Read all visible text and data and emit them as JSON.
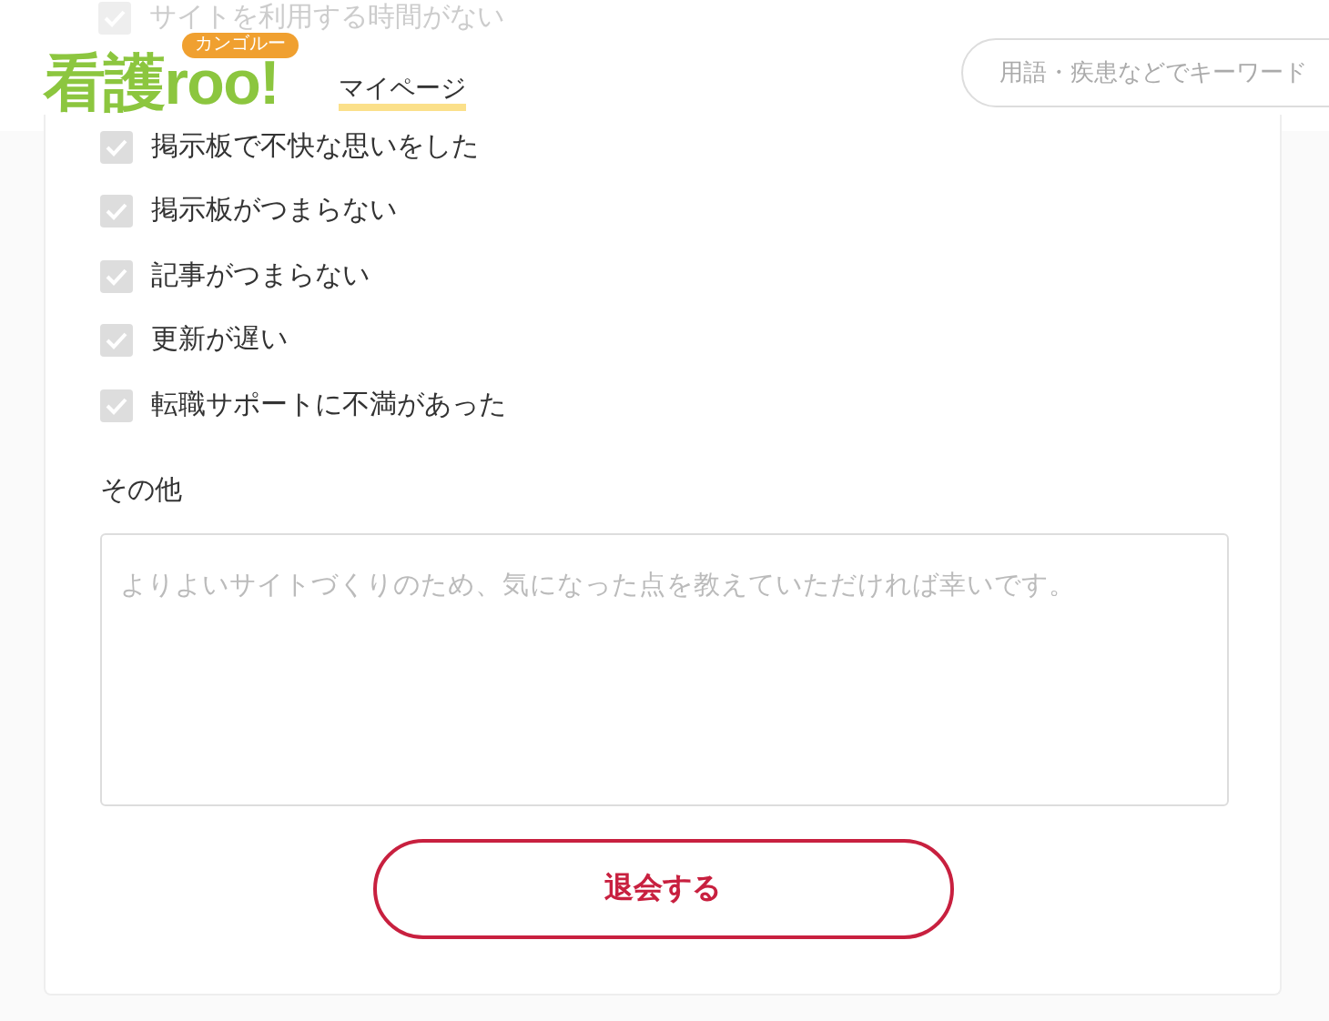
{
  "header": {
    "logo": {
      "main": "看護roo!",
      "bubble": "カンゴルー"
    },
    "nav_link": "マイページ",
    "search": {
      "placeholder": "用語・疾患などでキーワード"
    }
  },
  "reasons": [
    {
      "label": "サイトを利用する時間がない",
      "checked": true
    },
    {
      "label": "掲示板で不快な思いをした",
      "checked": true
    },
    {
      "label": "掲示板がつまらない",
      "checked": true
    },
    {
      "label": "記事がつまらない",
      "checked": true
    },
    {
      "label": "更新が遅い",
      "checked": true
    },
    {
      "label": "転職サポートに不満があった",
      "checked": true
    }
  ],
  "other": {
    "label": "その他",
    "placeholder": "よりよいサイトづくりのため、気になった点を教えていただければ幸いです。"
  },
  "submit_button": "退会する"
}
